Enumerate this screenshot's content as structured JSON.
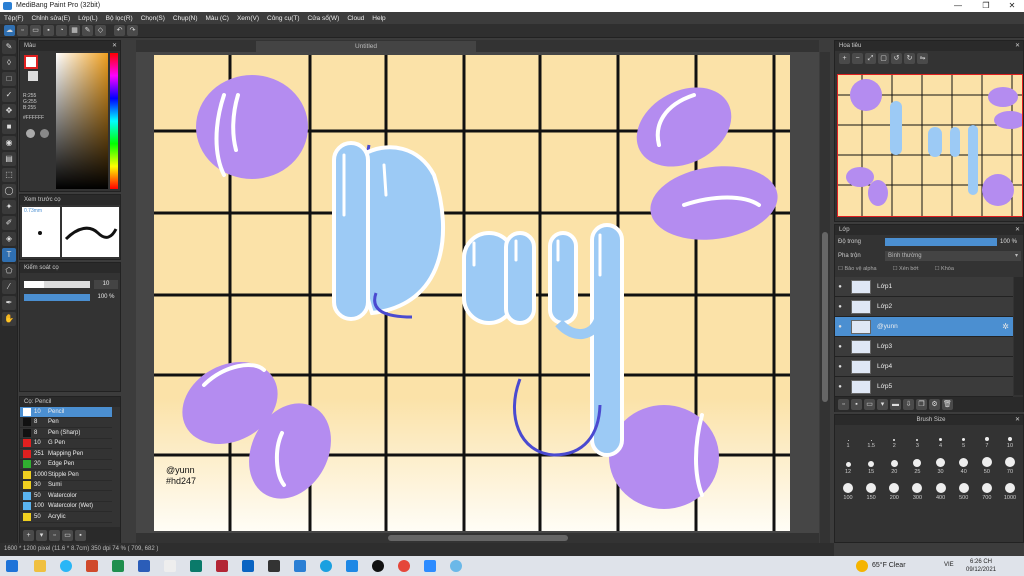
{
  "window": {
    "title": "MediBang Paint Pro (32bit)"
  },
  "menu": [
    "Tệp(F)",
    "Chỉnh sửa(E)",
    "Lớp(L)",
    "Bộ lọc(R)",
    "Chọn(S)",
    "Chụp(N)",
    "Màu (C)",
    "Xem(V)",
    "Công cụ(T)",
    "Cửa sổ(W)",
    "Cloud",
    "Help"
  ],
  "canvas": {
    "tab_title": "Untitled",
    "watermark_line1": "@yunn",
    "watermark_line2": "#hd247"
  },
  "color_panel": {
    "title": "Màu",
    "r": "R:255",
    "g": "G:255",
    "b": "B:255",
    "hex": "#FFFFFF"
  },
  "brush_preview": {
    "title": "Xem trước cọ",
    "size": "0.73mm"
  },
  "brush_control": {
    "title": "Kiểm soát cọ",
    "size_value": "10",
    "opacity_value": "100 %"
  },
  "brush_list": {
    "title": "Cọ: Pencil",
    "items": [
      {
        "size": "10",
        "name": "Pencil",
        "color": "#ffffff",
        "selected": true
      },
      {
        "size": "8",
        "name": "Pen",
        "color": "#111111"
      },
      {
        "size": "8",
        "name": "Pen (Sharp)",
        "color": "#111111"
      },
      {
        "size": "10",
        "name": "G Pen",
        "color": "#e02020"
      },
      {
        "size": "251",
        "name": "Mapping Pen",
        "color": "#e02020"
      },
      {
        "size": "20",
        "name": "Edge Pen",
        "color": "#30b030"
      },
      {
        "size": "1000",
        "name": "Stipple Pen",
        "color": "#f0d020"
      },
      {
        "size": "30",
        "name": "Sumi",
        "color": "#f0d020"
      },
      {
        "size": "50",
        "name": "Watercolor",
        "color": "#5ab4f0"
      },
      {
        "size": "100",
        "name": "Watercolor (Wet)",
        "color": "#5ab4f0"
      },
      {
        "size": "50",
        "name": "Acrylic",
        "color": "#f0d020"
      }
    ]
  },
  "navigator": {
    "title": "Hoa tiêu"
  },
  "layers": {
    "title": "Lớp",
    "opacity_label": "Độ trong",
    "opacity_value": "100 %",
    "blend_label": "Pha trộn",
    "blend_value": "Bình thường",
    "protect_alpha": "Bảo vệ alpha",
    "clipping": "Xén bớt",
    "lock": "Khóa",
    "items": [
      {
        "name": "Lớp1",
        "selected": false
      },
      {
        "name": "Lớp2",
        "selected": false
      },
      {
        "name": "@yunn",
        "selected": true
      },
      {
        "name": "Lớp3",
        "selected": false
      },
      {
        "name": "Lớp4",
        "selected": false
      },
      {
        "name": "Lớp5",
        "selected": false
      }
    ]
  },
  "brush_size": {
    "title": "Brush Size",
    "row1": [
      "1",
      "1.5",
      "2",
      "3",
      "4",
      "5",
      "7",
      "10"
    ],
    "row2": [
      "12",
      "15",
      "20",
      "25",
      "30",
      "40",
      "50",
      "70"
    ],
    "row3": [
      "100",
      "150",
      "200",
      "300",
      "400",
      "500",
      "700",
      "1000"
    ]
  },
  "status": {
    "text": "1600 * 1200 pixel  (11.6 * 8.7cm)  350 dpi  74 %  ( 709, 682 )"
  },
  "taskbar": {
    "weather": "65°F  Clear",
    "lang": "VIE",
    "time": "6:26 CH",
    "date": "09/12/2021"
  },
  "colors": {
    "blob": "#b48cf0",
    "letter": "#9ccaf5",
    "outline": "#4a4ad0",
    "grid": "#111111",
    "bg": "#fbe2a8",
    "accent": "#4b8fd1"
  }
}
